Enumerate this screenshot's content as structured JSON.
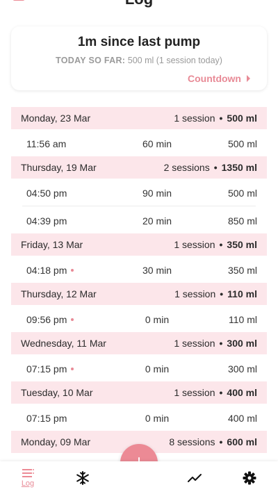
{
  "header": {
    "title": "Log"
  },
  "summary": {
    "headline": "1m since last pump",
    "today_label": "TODAY SO FAR:",
    "today_value": "500 ml",
    "today_sessions": "(1 session today)",
    "countdown_label": "Countdown"
  },
  "days": [
    {
      "date": "Monday, 23 Mar",
      "sessions": "1 session",
      "total": "500 ml",
      "entries": [
        {
          "time": "11:56 am",
          "duration": "60 min",
          "volume": "500 ml",
          "flag": false
        }
      ]
    },
    {
      "date": "Thursday, 19 Mar",
      "sessions": "2 sessions",
      "total": "1350 ml",
      "entries": [
        {
          "time": "04:50 pm",
          "duration": "90 min",
          "volume": "500 ml",
          "flag": false
        },
        {
          "time": "04:39 pm",
          "duration": "20 min",
          "volume": "850 ml",
          "flag": false
        }
      ]
    },
    {
      "date": "Friday, 13 Mar",
      "sessions": "1 session",
      "total": "350 ml",
      "entries": [
        {
          "time": "04:18 pm",
          "duration": "30 min",
          "volume": "350 ml",
          "flag": true
        }
      ]
    },
    {
      "date": "Thursday, 12 Mar",
      "sessions": "1 session",
      "total": "110 ml",
      "entries": [
        {
          "time": "09:56 pm",
          "duration": "0 min",
          "volume": "110 ml",
          "flag": true
        }
      ]
    },
    {
      "date": "Wednesday, 11 Mar",
      "sessions": "1 session",
      "total": "300 ml",
      "entries": [
        {
          "time": "07:15 pm",
          "duration": "0 min",
          "volume": "300 ml",
          "flag": true
        }
      ]
    },
    {
      "date": "Tuesday, 10 Mar",
      "sessions": "1 session",
      "total": "400 ml",
      "entries": [
        {
          "time": "07:15 pm",
          "duration": "0 min",
          "volume": "400 ml",
          "flag": false
        }
      ]
    },
    {
      "date": "Monday, 09 Mar",
      "sessions": "8 sessions",
      "total": "600 ml",
      "entries": []
    }
  ],
  "nav": {
    "log_label": "Log",
    "items": [
      "list-icon",
      "snowflake-icon",
      "trend-icon",
      "gear-icon"
    ],
    "fab_icon": "plus-icon"
  },
  "colors": {
    "accent": "#ec8a95",
    "header_bg": "#fce6ea"
  },
  "separator": "•"
}
